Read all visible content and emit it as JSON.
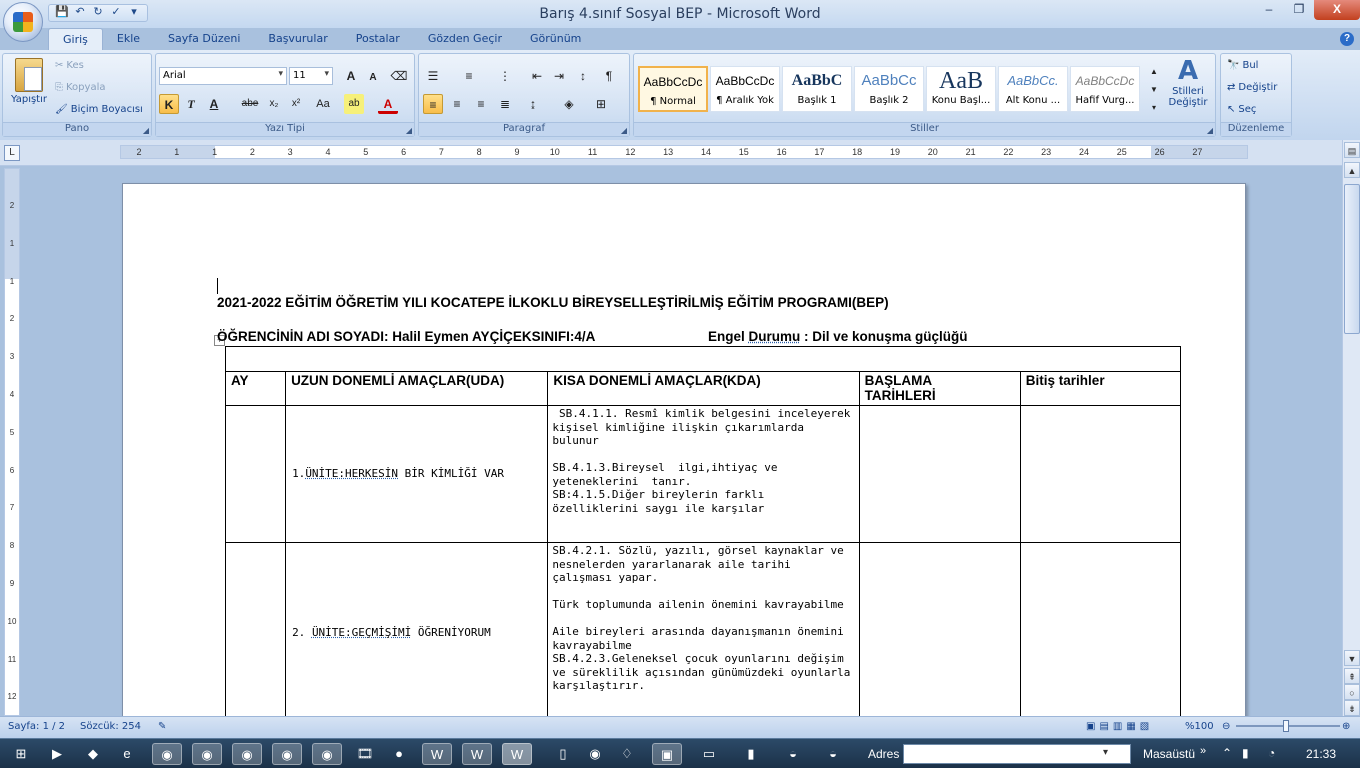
{
  "window": {
    "title": "Barış 4.sınıf Sosyal BEP - Microsoft Word",
    "minimize": "–",
    "maximize": "❐",
    "close": "X"
  },
  "ribbon_tabs": [
    "Giriş",
    "Ekle",
    "Sayfa Düzeni",
    "Başvurular",
    "Postalar",
    "Gözden Geçir",
    "Görünüm"
  ],
  "clipboard": {
    "paste": "Yapıştır",
    "cut": "Kes",
    "copy": "Kopyala",
    "format_painter": "Biçim Boyacısı",
    "group": "Pano"
  },
  "font": {
    "name": "Arial",
    "size": "11",
    "group": "Yazı Tipi",
    "bold": "K",
    "italic": "T",
    "underline": "A",
    "strike": "abe",
    "sub": "x₂",
    "sup": "x²",
    "case": "Aa",
    "grow": "A",
    "shrink": "A"
  },
  "paragraph": {
    "group": "Paragraf"
  },
  "styles": {
    "group": "Stiller",
    "items": [
      {
        "sample": "AaBbCcDc",
        "name": "¶ Normal"
      },
      {
        "sample": "AaBbCcDc",
        "name": "¶ Aralık Yok"
      },
      {
        "sample": "AaBbC",
        "name": "Başlık 1"
      },
      {
        "sample": "AaBbCc",
        "name": "Başlık 2"
      },
      {
        "sample": "AaB",
        "name": "Konu Başl..."
      },
      {
        "sample": "AaBbCc.",
        "name": "Alt Konu ..."
      },
      {
        "sample": "AaBbCcDc",
        "name": "Hafif Vurg..."
      }
    ],
    "change": "Stilleri Değiştir"
  },
  "editing": {
    "group": "Düzenleme",
    "find": "Bul",
    "replace": "Değiştir",
    "select": "Seç"
  },
  "ruler_numbers": [
    "2",
    "1",
    "1",
    "2",
    "3",
    "4",
    "5",
    "6",
    "7",
    "8",
    "9",
    "10",
    "11",
    "12",
    "13",
    "14",
    "15",
    "16",
    "17",
    "18",
    "19",
    "20",
    "21",
    "22",
    "23",
    "24",
    "25",
    "26",
    "27"
  ],
  "document": {
    "heading": "2021-2022 EĞİTİM ÖĞRETİM YILI KOCATEPE İLKOKLU BİREYSELLEŞTİRİLMİŞ EĞİTİM PROGRAMI(BEP)",
    "student_label": "ÖĞRENCİNİN ADI SOYADI:  Halil Eymen AYÇİÇEKSINIFI:4/A",
    "disability_prefix": "Engel ",
    "disability_word": "Durumu",
    "disability_suffix": " : Dil ve konuşma güçlüğü",
    "table": {
      "headers": [
        "AY",
        "UZUN DONEMLİ AMAÇLAR(UDA)",
        "KISA DONEMLİ AMAÇLAR(KDA)",
        "BAŞLAMA\nTARİHLERİ",
        "Bitiş tarihler"
      ],
      "rows": [
        {
          "unit_prefix": "1.",
          "unit_title": "ÜNİTE:HERKESİN",
          "unit_rest": " BİR KİMLİĞİ VAR",
          "kda": " SB.4.1.1. Resmî kimlik belgesini incelеyerek kişisel kimliğine ilişkin çıkarımlarda bulunur\n\nSB.4.1.3.Bireysel  ilgi,ihtiyaç ve yeteneklerini  tanır.\nSB:4.1.5.Diğer bireylerin farklı özelliklerini saygı ile karşılar"
        },
        {
          "unit_prefix": "2. ",
          "unit_title": "ÜNİTE:GEÇMİŞİMİ",
          "unit_rest": " ÖĞRENİYORUM",
          "kda": "SB.4.2.1. Sözlü, yazılı, görsel kaynaklar ve nesnelerden yararlanarak aile tarihi çalışması yapar.\n\nTürk toplumunda ailenin önemini kavrayabilme\n\nAile bireyleri arasında dayanışmanın önemini kavrayabilme\nSB.4.2.3.Geleneksel çocuk oyunlarını değişim ve süreklilik açısından günümüzdeki oyunlarla karşılaştırır."
        }
      ]
    }
  },
  "status": {
    "page": "Sayfa: 1 / 2",
    "words": "Sözcük: 254",
    "zoom": "%100",
    "zoom_level": 0.5
  },
  "taskbar": {
    "address_label": "Adres",
    "desktop": "Masaüstü",
    "clock": "21:33"
  }
}
